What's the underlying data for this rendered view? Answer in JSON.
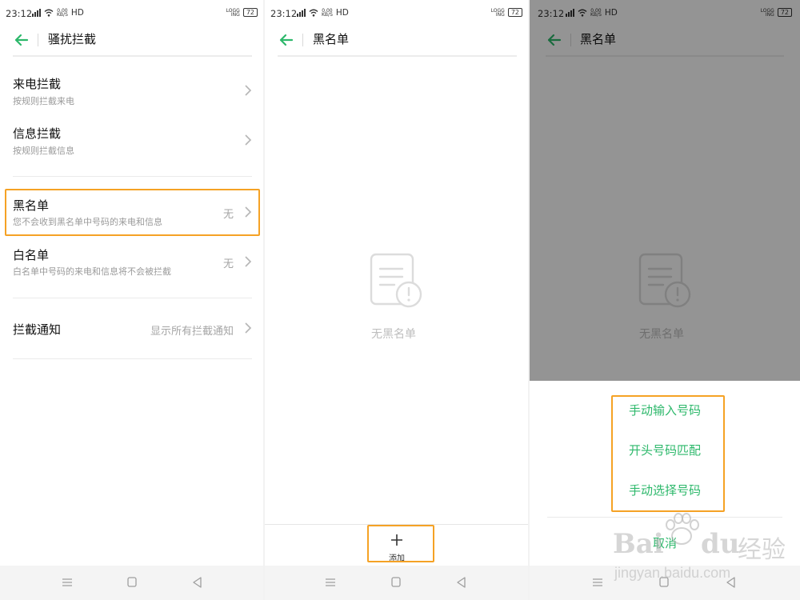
{
  "colors": {
    "accent": "#2db86b",
    "highlight": "#f5a225"
  },
  "status_bar": {
    "time": "23:12",
    "speed_top": "0.00",
    "speed_bottom": "KB/S",
    "hd": "HD",
    "logo_top": "LOGG",
    "logo_bottom": "ING",
    "battery": "72"
  },
  "panel1": {
    "title": "骚扰拦截",
    "items": [
      {
        "title": "来电拦截",
        "subtitle": "按规则拦截来电",
        "value": ""
      },
      {
        "title": "信息拦截",
        "subtitle": "按规则拦截信息",
        "value": ""
      },
      {
        "title": "黑名单",
        "subtitle": "您不会收到黑名单中号码的来电和信息",
        "value": "无"
      },
      {
        "title": "白名单",
        "subtitle": "白名单中号码的来电和信息将不会被拦截",
        "value": "无"
      },
      {
        "title": "拦截通知",
        "subtitle": "",
        "value": "显示所有拦截通知"
      }
    ]
  },
  "panel2": {
    "title": "黑名单",
    "empty_text": "无黑名单",
    "add_label": "添加",
    "add_icon": "plus-icon"
  },
  "panel3": {
    "title": "黑名单",
    "empty_text": "无黑名单",
    "sheet_items": [
      "手动输入号码",
      "开头号码匹配",
      "手动选择号码"
    ],
    "cancel": "取消",
    "watermark_brand": "Bai",
    "watermark_du": "du",
    "watermark_jingyan": "经验",
    "watermark_url": "jingyan.baidu.com"
  },
  "nav_icons": [
    "menu-icon",
    "home-icon",
    "back-triangle-icon"
  ]
}
